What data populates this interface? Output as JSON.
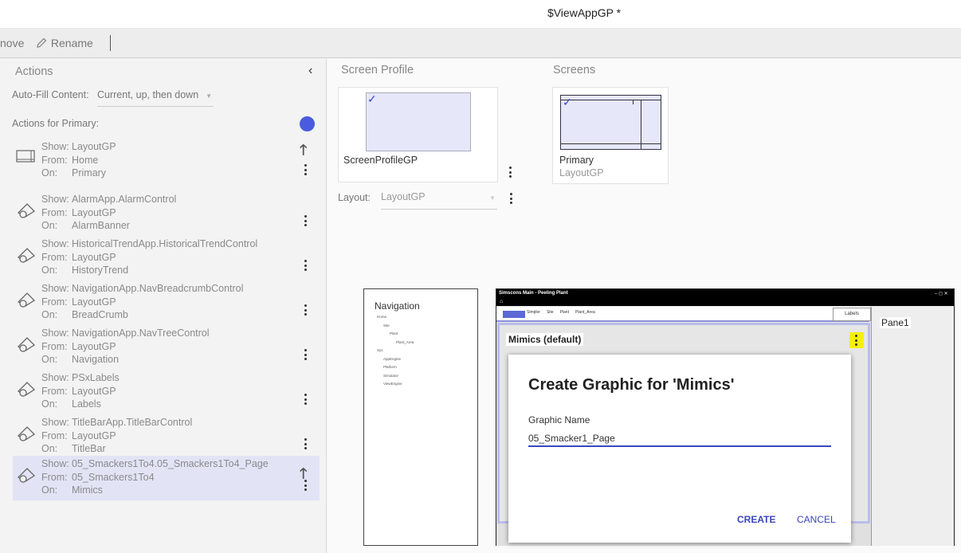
{
  "window": {
    "title": "$ViewAppGP *"
  },
  "toolbar": {
    "remove_label": "nove",
    "rename_label": "Rename"
  },
  "left": {
    "header": "Actions",
    "autofill_label": "Auto-Fill Content:",
    "autofill_value": "Current, up, then down",
    "actions_for_label": "Actions for Primary:",
    "key_show": "Show:",
    "key_from": "From:",
    "key_on": "On:",
    "actions": [
      {
        "show": "LayoutGP",
        "from": "Home",
        "on": "Primary"
      },
      {
        "show": "AlarmApp.AlarmControl",
        "from": "LayoutGP",
        "on": "AlarmBanner"
      },
      {
        "show": "HistoricalTrendApp.HistoricalTrendControl",
        "from": "LayoutGP",
        "on": "HistoryTrend"
      },
      {
        "show": "NavigationApp.NavBreadcrumbControl",
        "from": "LayoutGP",
        "on": "BreadCrumb"
      },
      {
        "show": "NavigationApp.NavTreeControl",
        "from": "LayoutGP",
        "on": "Navigation"
      },
      {
        "show": "PSxLabels",
        "from": "LayoutGP",
        "on": "Labels"
      },
      {
        "show": "TitleBarApp.TitleBarControl",
        "from": "LayoutGP",
        "on": "TitleBar"
      },
      {
        "show": "05_Smackers1To4.05_Smackers1To4_Page",
        "from": "05_Smackers1To4",
        "on": "Mimics"
      }
    ]
  },
  "right": {
    "screen_profile_header": "Screen Profile",
    "screens_header": "Screens",
    "profile_name": "ScreenProfileGP",
    "screen_name": "Primary",
    "screen_layout": "LayoutGP",
    "layout_label": "Layout:",
    "layout_value": "LayoutGP"
  },
  "preview": {
    "nav_title": "Navigation",
    "nav_items": [
      "Home",
      "Site",
      "Plant",
      "Plant_Area",
      "Sys",
      "AppEngine",
      "Platform",
      "Simulator",
      "ViewEngine"
    ],
    "app_title": "Simscons Main - Peeling Plant",
    "breadcrumb": [
      "Simplor",
      "Site",
      "Plant",
      "Plant_Area"
    ],
    "labels_btn": "Labels",
    "pane1": "Pane1",
    "mimics_label": "Mimics (default)",
    "dialog": {
      "title": "Create Graphic for 'Mimics'",
      "field_label": "Graphic Name",
      "field_value": "05_Smacker1_Page",
      "create": "CREATE",
      "cancel": "CANCEL"
    }
  },
  "colors": {
    "accent": "#3a46c0",
    "selected_row": "#e2e4f6",
    "dot": "#4a5be0",
    "highlight": "#f5f000"
  }
}
